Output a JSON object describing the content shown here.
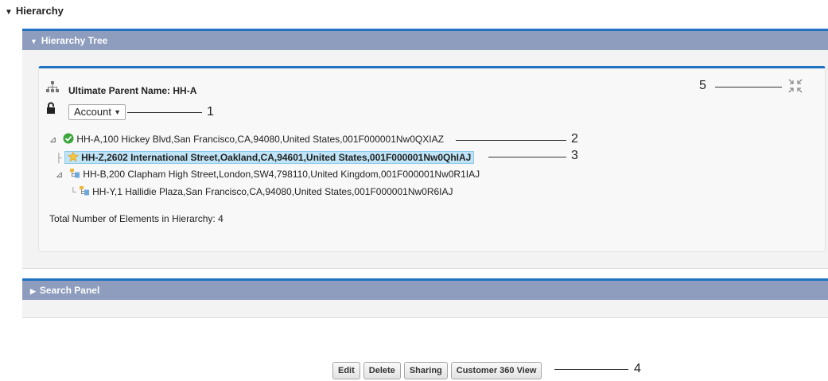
{
  "hierarchy_heading": "Hierarchy",
  "tree_section": {
    "title": "Hierarchy Tree"
  },
  "parent_label": "Ultimate Parent Name: HH-A",
  "object_select": {
    "value": "Account"
  },
  "tree": [
    {
      "text": "HH-A,100 Hickey Blvd,San Francisco,CA,94080,United States,001F000001Nw0QXIAZ",
      "icon": "check-circle-icon"
    },
    {
      "text": "HH-Z,2602 International Street,Oakland,CA,94601,United States,001F000001Nw0QhIAJ",
      "icon": "star-icon",
      "selected": true
    },
    {
      "text": "HH-B,200 Clapham High Street,London,SW4,798110,United Kingdom,001F000001Nw0R1IAJ",
      "icon": "hierarchy-node-icon"
    },
    {
      "text": "HH-Y,1 Hallidie Plaza,San Francisco,CA,94080,United States,001F000001Nw0R6IAJ",
      "icon": "hierarchy-node-icon"
    }
  ],
  "total_label": "Total Number of Elements in Hierarchy: 4",
  "search_section": {
    "title": "Search Panel"
  },
  "buttons": {
    "edit": "Edit",
    "delete": "Delete",
    "sharing": "Sharing",
    "c360": "Customer 360 View"
  },
  "callouts": {
    "c1": "1",
    "c2": "2",
    "c3": "3",
    "c4": "4",
    "c5": "5"
  },
  "colors": {
    "accent": "#1f71c2",
    "bar": "#8e9dbe",
    "selected": "#bfe4f7"
  }
}
